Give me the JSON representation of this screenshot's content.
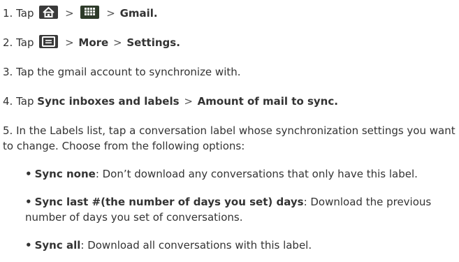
{
  "steps": [
    {
      "num": "1.",
      "tap": "Tap",
      "gt1": ">",
      "gt2": ">",
      "target": "Gmail",
      "end": "."
    },
    {
      "num": "2.",
      "tap": "Tap",
      "gt1": ">",
      "gt2": ">",
      "more": "More",
      "target": "Settings",
      "end": "."
    },
    {
      "num": "3.",
      "text": "Tap the gmail account to synchronize with."
    },
    {
      "num": "4.",
      "tap": "Tap",
      "option": "Sync inboxes and labels",
      "gt": ">",
      "target": "Amount of mail to sync",
      "end": "."
    },
    {
      "num": "5.",
      "text": "In the Labels list, tap a conversation label whose synchronization settings you want to change. Choose from the following options:"
    }
  ],
  "options": [
    {
      "label": "Sync none",
      "desc": ": Don’t download any conversations that only have this label."
    },
    {
      "label": "Sync last #(the number of days you set) days",
      "desc": ": Download the previous number of days you set of conversations."
    },
    {
      "label": "Sync all",
      "desc": ": Download all conversations with this label."
    }
  ],
  "icons": {
    "home": "home-icon",
    "apps": "apps-grid-icon",
    "menu": "menu-icon"
  },
  "colors": {
    "text": "#333333",
    "icon_bg": "#3a3a3a"
  }
}
